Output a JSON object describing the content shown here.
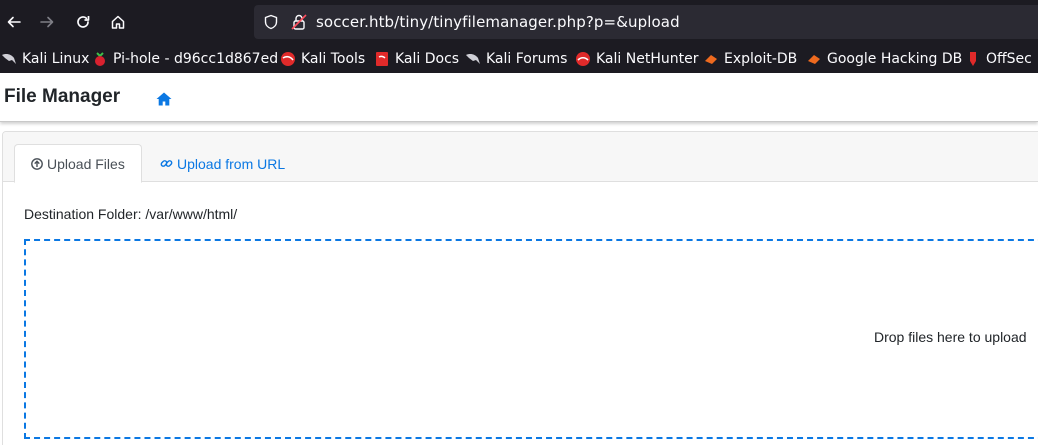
{
  "browser": {
    "url": "soccer.htb/tiny/tinyfilemanager.php?p=&upload",
    "nav_icons": [
      "back-arrow-icon",
      "forward-arrow-icon",
      "reload-icon",
      "home-icon"
    ]
  },
  "bookmarks": [
    {
      "label": "Kali Linux",
      "icon": "kali-dragon-icon"
    },
    {
      "label": "Pi-hole - d96cc1d867ed",
      "icon": "raspberry-icon"
    },
    {
      "label": "Kali Tools",
      "icon": "kali-tools-icon"
    },
    {
      "label": "Kali Docs",
      "icon": "kali-docs-icon"
    },
    {
      "label": "Kali Forums",
      "icon": "kali-dragon-icon"
    },
    {
      "label": "Kali NetHunter",
      "icon": "nethunter-icon"
    },
    {
      "label": "Exploit-DB",
      "icon": "exploit-db-icon"
    },
    {
      "label": "Google Hacking DB",
      "icon": "ghdb-icon"
    },
    {
      "label": "OffSec",
      "icon": "offsec-icon"
    }
  ],
  "app": {
    "brand": "File Manager",
    "home_icon": "home-icon"
  },
  "tabs": [
    {
      "label": "Upload Files",
      "icon": "upload-circle-icon",
      "active": true
    },
    {
      "label": "Upload from URL",
      "icon": "link-icon",
      "active": false
    }
  ],
  "destination": "Destination Folder: /var/www/html/",
  "dropzone": {
    "message": "Drop files here to upload"
  },
  "colors": {
    "accent": "#0b78e3",
    "browser_chrome": "#1c1b22",
    "urlbar": "#2b2a33"
  }
}
